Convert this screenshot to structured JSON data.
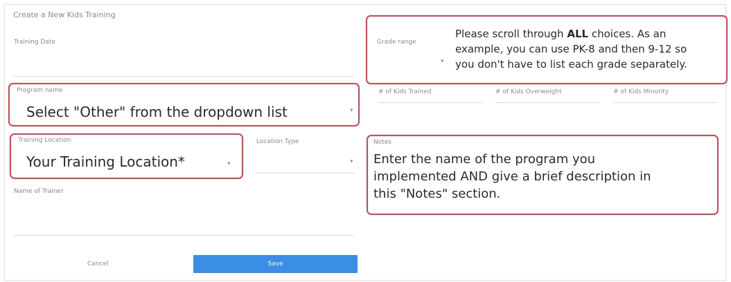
{
  "form": {
    "title": "Create a New Kids Training",
    "training_date_label": "Training Date",
    "grade_range_label": "Grade range",
    "program_label": "Program name",
    "program_value": "Select \"Other\" from the dropdown list",
    "num_kids_trained_label": "# of Kids Trained",
    "num_kids_overweight_label": "# of Kids Overweight",
    "num_kids_minority_label": "# of Kids Minority",
    "training_location_label": "Training Location",
    "training_location_value": "Your Training Location*",
    "location_type_label": "Location Type",
    "notes_label": "Notes",
    "trainer_name_label": "Name of Trainer",
    "cancel_label": "Cancel",
    "save_label": "Save"
  },
  "callouts": {
    "grade_instructions_1": "Please scroll through",
    "grade_instructions_bold": "ALL",
    "grade_instructions_2": "choices. As an",
    "grade_instructions_3": "example, you can use PK-8 and then 9-12 so",
    "grade_instructions_4": "you don't have to list each grade separately.",
    "notes_line_1": "Enter the name of the program you",
    "notes_line_2": "implemented AND give a brief description in",
    "notes_line_3": "this \"Notes\" section."
  },
  "colors": {
    "highlight_border": "#d8474d",
    "save_button": "#3a8ee6"
  }
}
